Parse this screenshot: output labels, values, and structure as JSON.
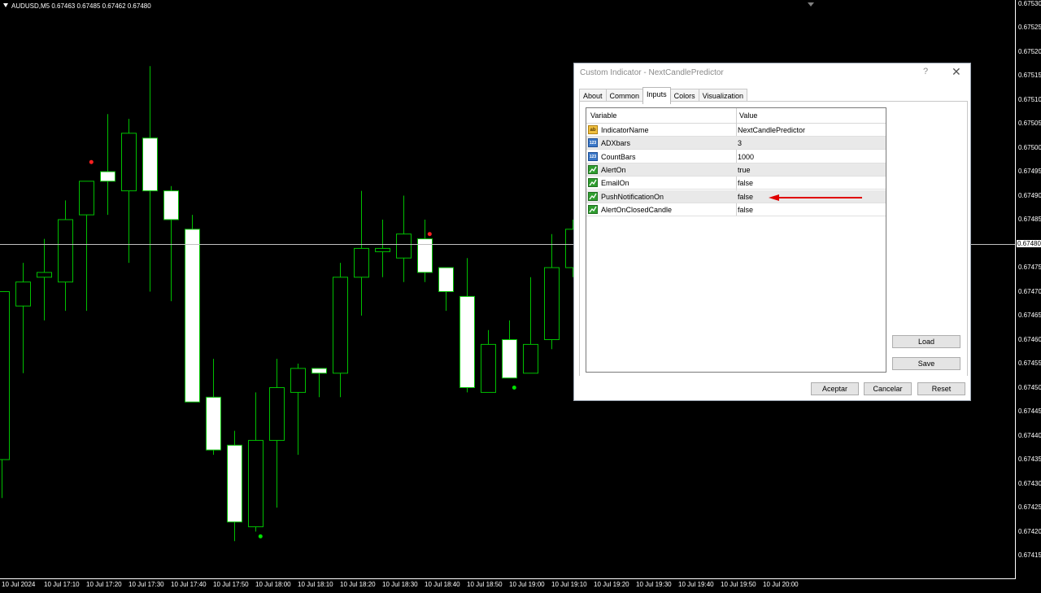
{
  "chart": {
    "symbol_info": "AUDUSD,M5  0.67463 0.67485 0.67462 0.67480",
    "current_price": "0.67480",
    "price_labels": [
      "0.67530",
      "0.67525",
      "0.67520",
      "0.67515",
      "0.67510",
      "0.67505",
      "0.67500",
      "0.67495",
      "0.67490",
      "0.67485",
      "0.67475",
      "0.67470",
      "0.67465",
      "0.67460",
      "0.67455",
      "0.67450",
      "0.67445",
      "0.67440",
      "0.67435",
      "0.67430",
      "0.67425",
      "0.67420",
      "0.67415"
    ],
    "time_labels": [
      "10 Jul 2024",
      "10 Jul 17:10",
      "10 Jul 17:20",
      "10 Jul 17:30",
      "10 Jul 17:40",
      "10 Jul 17:50",
      "10 Jul 18:00",
      "10 Jul 18:10",
      "10 Jul 18:20",
      "10 Jul 18:30",
      "10 Jul 18:40",
      "10 Jul 18:50",
      "10 Jul 19:00",
      "10 Jul 19:10",
      "10 Jul 19:20",
      "10 Jul 19:30",
      "10 Jul 19:40",
      "10 Jul 19:50",
      "10 Jul 20:00"
    ],
    "colors": {
      "background": "#000000",
      "candle_outline": "#00c000",
      "bull_body": "#000000",
      "bear_body": "#ffffff",
      "up_dot": "#00e000",
      "down_dot": "#ff2020",
      "bid_line": "#c0c0c0"
    },
    "candles": [
      {
        "o": 0.67435,
        "h": 0.6747,
        "l": 0.67427,
        "c": 0.6747
      },
      {
        "o": 0.67467,
        "h": 0.67476,
        "l": 0.67453,
        "c": 0.67472
      },
      {
        "o": 0.67473,
        "h": 0.67481,
        "l": 0.67464,
        "c": 0.67474
      },
      {
        "o": 0.67472,
        "h": 0.67489,
        "l": 0.67466,
        "c": 0.67485
      },
      {
        "o": 0.67486,
        "h": 0.67493,
        "l": 0.67466,
        "c": 0.67493
      },
      {
        "o": 0.67495,
        "h": 0.67507,
        "l": 0.67486,
        "c": 0.67493
      },
      {
        "o": 0.67491,
        "h": 0.67506,
        "l": 0.67476,
        "c": 0.67503
      },
      {
        "o": 0.67502,
        "h": 0.67517,
        "l": 0.6747,
        "c": 0.67491
      },
      {
        "o": 0.67491,
        "h": 0.67492,
        "l": 0.67468,
        "c": 0.67485
      },
      {
        "o": 0.67483,
        "h": 0.67486,
        "l": 0.67447,
        "c": 0.67447
      },
      {
        "o": 0.67448,
        "h": 0.67456,
        "l": 0.67436,
        "c": 0.67437
      },
      {
        "o": 0.67438,
        "h": 0.67441,
        "l": 0.67418,
        "c": 0.67422
      },
      {
        "o": 0.67421,
        "h": 0.67449,
        "l": 0.6742,
        "c": 0.67439
      },
      {
        "o": 0.67439,
        "h": 0.67456,
        "l": 0.67425,
        "c": 0.6745
      },
      {
        "o": 0.67449,
        "h": 0.67455,
        "l": 0.67436,
        "c": 0.67454
      },
      {
        "o": 0.67454,
        "h": 0.67454,
        "l": 0.67448,
        "c": 0.67453
      },
      {
        "o": 0.67453,
        "h": 0.67476,
        "l": 0.67448,
        "c": 0.67473
      },
      {
        "o": 0.67473,
        "h": 0.67491,
        "l": 0.67465,
        "c": 0.67479
      },
      {
        "o": 0.67479,
        "h": 0.67485,
        "l": 0.67473,
        "c": 0.67479
      },
      {
        "o": 0.67477,
        "h": 0.6749,
        "l": 0.67472,
        "c": 0.67482
      },
      {
        "o": 0.67481,
        "h": 0.67485,
        "l": 0.67472,
        "c": 0.67474
      },
      {
        "o": 0.67475,
        "h": 0.67475,
        "l": 0.67466,
        "c": 0.6747
      },
      {
        "o": 0.67469,
        "h": 0.67477,
        "l": 0.67449,
        "c": 0.6745
      },
      {
        "o": 0.67449,
        "h": 0.67462,
        "l": 0.67449,
        "c": 0.67459
      },
      {
        "o": 0.6746,
        "h": 0.67464,
        "l": 0.67452,
        "c": 0.67452
      },
      {
        "o": 0.67453,
        "h": 0.67473,
        "l": 0.67453,
        "c": 0.67459
      },
      {
        "o": 0.6746,
        "h": 0.67482,
        "l": 0.67458,
        "c": 0.67475
      },
      {
        "o": 0.67475,
        "h": 0.67485,
        "l": 0.67473,
        "c": 0.67483
      }
    ],
    "signals": [
      {
        "index": 4,
        "price": 0.67497,
        "dir": "down"
      },
      {
        "index": 12,
        "price": 0.67419,
        "dir": "up"
      },
      {
        "index": 20,
        "price": 0.67482,
        "dir": "down"
      },
      {
        "index": 24,
        "price": 0.6745,
        "dir": "up"
      }
    ]
  },
  "dialog": {
    "title": "Custom Indicator - NextCandlePredictor",
    "help": "?",
    "close": "✕",
    "tabs": [
      "About",
      "Common",
      "Inputs",
      "Colors",
      "Visualization"
    ],
    "active_tab": "Inputs",
    "headers": {
      "variable": "Variable",
      "value": "Value"
    },
    "rows": [
      {
        "name": "IndicatorName",
        "value": "NextCandlePredictor",
        "icon": "ab"
      },
      {
        "name": "ADXbars",
        "value": "3",
        "icon": "123"
      },
      {
        "name": "CountBars",
        "value": "1000",
        "icon": "123"
      },
      {
        "name": "AlertOn",
        "value": "true",
        "icon": "bool"
      },
      {
        "name": "EmailOn",
        "value": "false",
        "icon": "bool"
      },
      {
        "name": "PushNotificationOn",
        "value": "false",
        "icon": "bool"
      },
      {
        "name": "AlertOnClosedCandle",
        "value": "false",
        "icon": "bool"
      }
    ],
    "icon_text": {
      "ab": "ab",
      "123": "123"
    },
    "buttons": {
      "load": "Load",
      "save": "Save",
      "ok": "Aceptar",
      "cancel": "Cancelar",
      "reset": "Reset"
    },
    "arrow_color": "#e00000"
  }
}
